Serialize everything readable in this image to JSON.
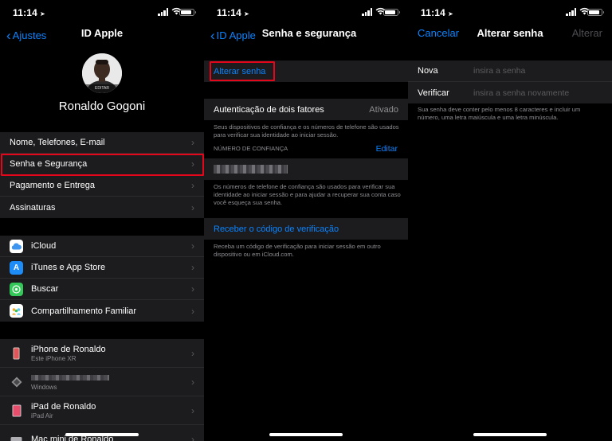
{
  "status": {
    "time": "11:14"
  },
  "colors": {
    "accent": "#0a84ff",
    "highlight": "#e4061a",
    "cell": "#1c1c1e"
  },
  "screen1": {
    "nav": {
      "back": "Ajustes",
      "title": "ID Apple"
    },
    "profile": {
      "edit_label": "EDITAR",
      "name": "Ronaldo Gogoni"
    },
    "account_items": [
      "Nome, Telefones, E-mail",
      "Senha e Segurança",
      "Pagamento e Entrega",
      "Assinaturas"
    ],
    "service_items": [
      {
        "label": "iCloud",
        "icon": "cloud-icon",
        "color": "#1e88e5"
      },
      {
        "label": "iTunes e App Store",
        "icon": "app-store-icon",
        "color": "#0a84ff"
      },
      {
        "label": "Buscar",
        "icon": "find-my-icon",
        "color": "#34c759"
      },
      {
        "label": "Compartilhamento Familiar",
        "icon": "family-sharing-icon",
        "color": "#5ac8fa"
      }
    ],
    "devices": [
      {
        "name": "iPhone de Ronaldo",
        "sub": "Este iPhone XR",
        "icon": "iphone-icon"
      },
      {
        "name": "",
        "sub": "Windows",
        "icon": "windows-icon"
      },
      {
        "name": "iPad de Ronaldo",
        "sub": "iPad Air",
        "icon": "ipad-icon"
      },
      {
        "name": "Mac mini de Ronaldo",
        "sub": "",
        "icon": "mac-mini-icon"
      }
    ]
  },
  "screen2": {
    "nav": {
      "back": "ID Apple",
      "title": "Senha e segurança"
    },
    "change_password": "Alterar senha",
    "two_factor": {
      "label": "Autenticação de dois fatores",
      "value": "Ativado"
    },
    "two_factor_note": "Seus dispositivos de confiança e os números de telefone são usados para verificar sua identidade ao iniciar sessão.",
    "trusted_header": "NÚMERO DE CONFIANÇA",
    "edit": "Editar",
    "phone_note": "Os números de telefone de confiança são usados para verificar sua identidade ao iniciar sessão e para ajudar a recuperar sua conta caso você esqueça sua senha.",
    "get_code": "Receber o código de verificação",
    "code_note": "Receba um código de verificação para iniciar sessão em outro dispositivo ou em iCloud.com."
  },
  "screen3": {
    "nav": {
      "cancel": "Cancelar",
      "title": "Alterar senha",
      "confirm": "Alterar"
    },
    "fields": [
      {
        "label": "Nova",
        "placeholder": "insira a senha"
      },
      {
        "label": "Verificar",
        "placeholder": "insira a senha novamente"
      }
    ],
    "note": "Sua senha deve conter pelo menos 8 caracteres e incluir um número, uma letra maiúscula e uma letra minúscula."
  }
}
